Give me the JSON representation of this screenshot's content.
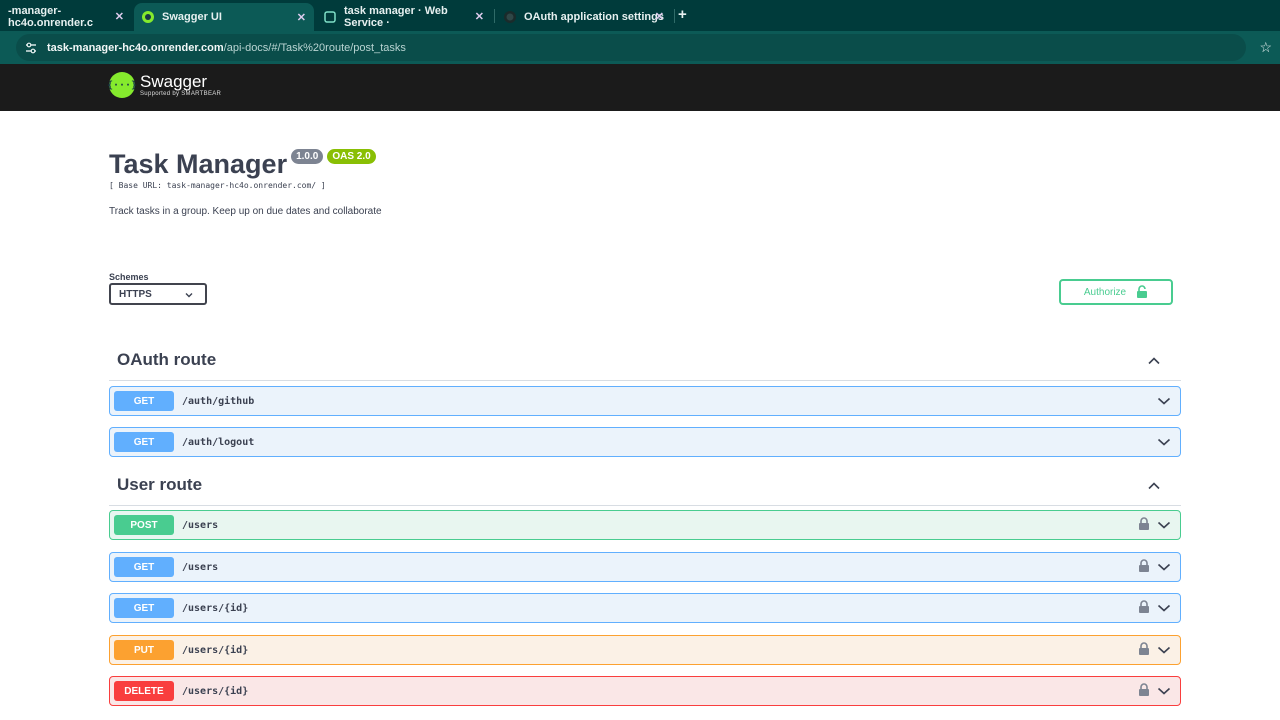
{
  "browser": {
    "tabs": [
      {
        "label": "-manager-hc4o.onrender.c",
        "active": false
      },
      {
        "label": "Swagger UI",
        "active": true
      },
      {
        "label": "task manager · Web Service ·",
        "active": false
      },
      {
        "label": "OAuth application settings",
        "active": false
      }
    ],
    "close_glyph": "✕",
    "new_tab": "+",
    "address_host": "task-manager-hc4o.onrender.com",
    "address_path": "/api-docs/#/Task%20route/post_tasks"
  },
  "swagger": {
    "logo_mark": "{···}",
    "logo_name": "Swagger",
    "logo_sub": "Supported by SMARTBEAR"
  },
  "info": {
    "title": "Task Manager",
    "version": "1.0.0",
    "oas": "OAS 2.0",
    "base_url": "[ Base URL: task-manager-hc4o.onrender.com/ ]",
    "description": "Track tasks in a group. Keep up on due dates and collaborate"
  },
  "schemes": {
    "label": "Schemes",
    "selected": "HTTPS"
  },
  "authorize_label": "Authorize",
  "sections": [
    {
      "title": "OAuth route",
      "operations": [
        {
          "method": "GET",
          "path": "/auth/github",
          "locked": false
        },
        {
          "method": "GET",
          "path": "/auth/logout",
          "locked": false
        }
      ]
    },
    {
      "title": "User route",
      "operations": [
        {
          "method": "POST",
          "path": "/users",
          "locked": true
        },
        {
          "method": "GET",
          "path": "/users",
          "locked": true
        },
        {
          "method": "GET",
          "path": "/users/{id}",
          "locked": true
        },
        {
          "method": "PUT",
          "path": "/users/{id}",
          "locked": true
        },
        {
          "method": "DELETE",
          "path": "/users/{id}",
          "locked": true
        }
      ]
    }
  ],
  "colors": {
    "get": "#61affe",
    "post": "#49cc90",
    "put": "#fca130",
    "delete": "#f93e3e"
  }
}
